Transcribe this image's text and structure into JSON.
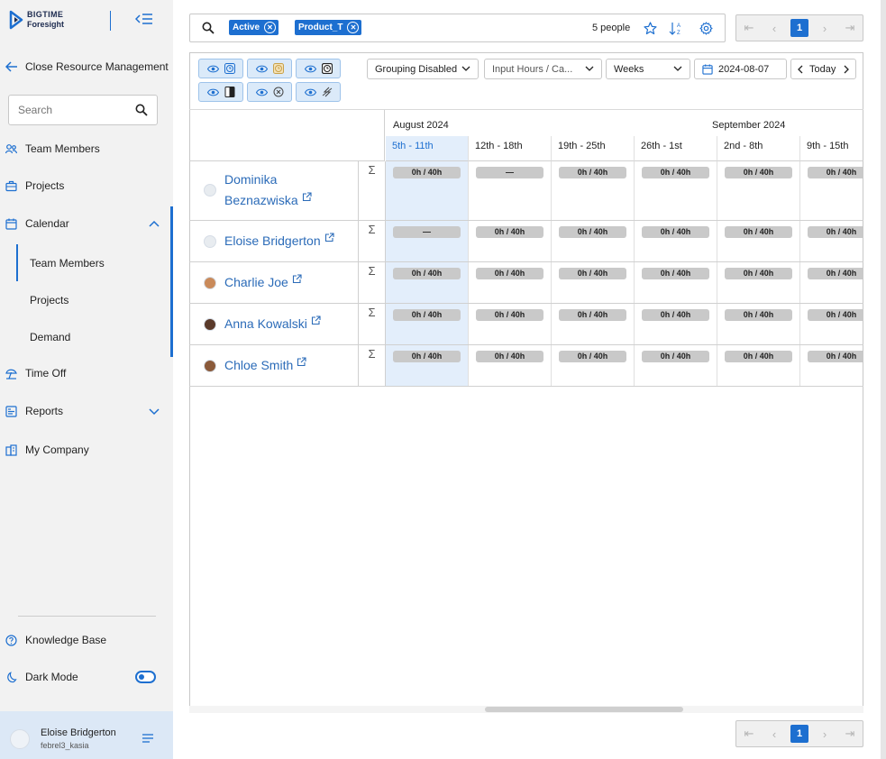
{
  "sidebar": {
    "logo_line1": "BIGTIME",
    "logo_line2": "Foresight",
    "back_label": "Close Resource Management",
    "search_placeholder": "Search",
    "nav": {
      "team_members": "Team Members",
      "projects": "Projects",
      "calendar": "Calendar",
      "calendar_sub": [
        "Team Members",
        "Projects",
        "Demand"
      ],
      "time_off": "Time Off",
      "reports": "Reports",
      "my_company": "My Company"
    },
    "knowledge_base": "Knowledge Base",
    "dark_mode": "Dark Mode",
    "user": {
      "name": "Eloise Bridgerton",
      "id": "febrel3_kasia"
    }
  },
  "toolbar": {
    "chips": [
      "Active",
      "Product_T"
    ],
    "people_count": "5 people",
    "page": "1"
  },
  "controls": {
    "grouping": "Grouping Disabled",
    "input_mode": "Input Hours / Ca...",
    "scale": "Weeks",
    "date": "2024-08-07",
    "today": "Today"
  },
  "calendar": {
    "months": [
      "August 2024",
      "September 2024"
    ],
    "weeks": [
      "5th - 11th",
      "12th - 18th",
      "19th - 25th",
      "26th - 1st",
      "2nd - 8th",
      "9th - 15th"
    ],
    "current_week_index": 0,
    "rows": [
      {
        "name_line1": "Dominika",
        "name_line2": "Beznazwiska",
        "cells": [
          "0h / 40h",
          "—",
          "0h / 40h",
          "0h / 40h",
          "0h / 40h",
          "0h / 40h"
        ]
      },
      {
        "name_line1": "Eloise Bridgerton",
        "cells": [
          "—",
          "0h / 40h",
          "0h / 40h",
          "0h / 40h",
          "0h / 40h",
          "0h / 40h"
        ]
      },
      {
        "name_line1": "Charlie Joe",
        "cells": [
          "0h / 40h",
          "0h / 40h",
          "0h / 40h",
          "0h / 40h",
          "0h / 40h",
          "0h / 40h"
        ]
      },
      {
        "name_line1": "Anna Kowalski",
        "cells": [
          "0h / 40h",
          "0h / 40h",
          "0h / 40h",
          "0h / 40h",
          "0h / 40h",
          "0h / 40h"
        ]
      },
      {
        "name_line1": "Chloe Smith",
        "cells": [
          "0h / 40h",
          "0h / 40h",
          "0h / 40h",
          "0h / 40h",
          "0h / 40h",
          "0h / 40h"
        ]
      }
    ],
    "sigma": "Σ"
  },
  "colors": {
    "accent": "#1d6fd0",
    "pill": "#c9c9c9",
    "current_week": "#e3eefb"
  }
}
